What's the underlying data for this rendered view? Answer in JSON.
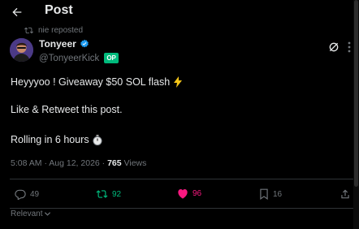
{
  "header": {
    "title": "Post"
  },
  "repost": {
    "text": "nie reposted"
  },
  "author": {
    "display_name": "Tonyeer",
    "handle": "@TonyeerKick",
    "op_badge": "OP"
  },
  "tweet": {
    "line1": "Heyyyoo ! Giveaway $50 SOL flash",
    "line1_emoji": "lightning-icon",
    "line2": "Like & Retweet this post.",
    "line3": "Rolling in 6 hours",
    "line3_emoji": "stopwatch-icon"
  },
  "meta": {
    "time_date": "5:08 AM · Aug 12, 2026 ·",
    "views_count": "765",
    "views_label": "Views"
  },
  "actions": {
    "replies": "49",
    "retweets": "92",
    "likes": "96",
    "bookmarks": "16"
  },
  "sort": {
    "label": "Relevant"
  },
  "colors": {
    "background": "#000000",
    "text": "#e7e9ea",
    "muted": "#71767b",
    "retweet_green": "#00ba7c",
    "like_pink": "#f91880",
    "verified_blue": "#1d9bf0"
  }
}
